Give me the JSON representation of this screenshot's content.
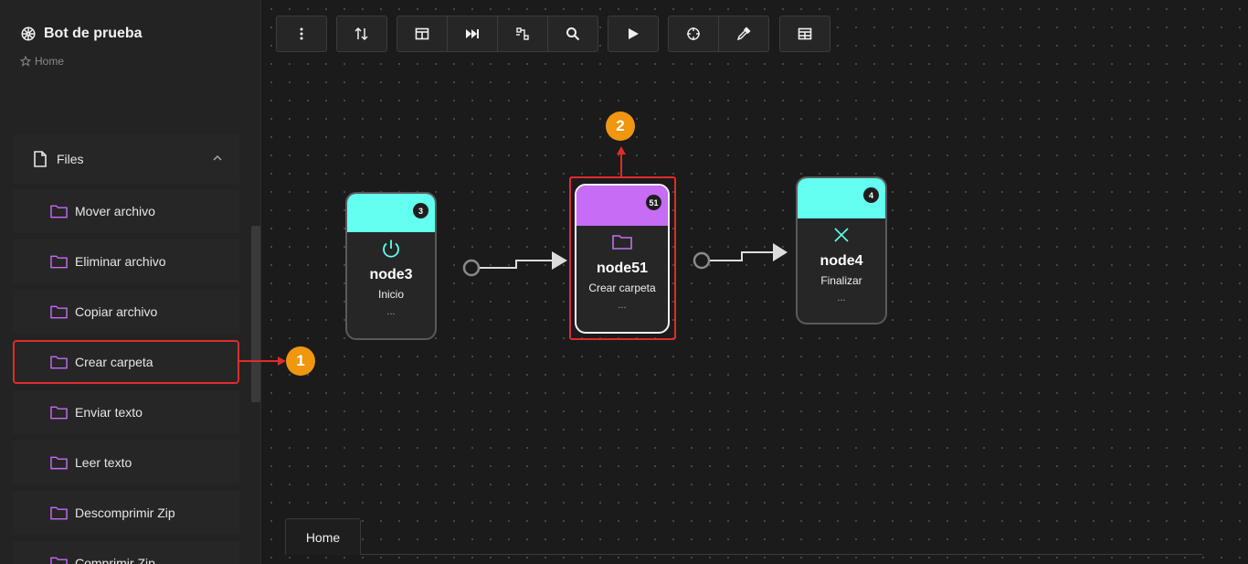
{
  "bot": {
    "title": "Bot de prueba",
    "breadcrumb": "Home"
  },
  "sidebar": {
    "section": "Files",
    "items": [
      {
        "label": "Mover archivo"
      },
      {
        "label": "Eliminar archivo"
      },
      {
        "label": "Copiar archivo"
      },
      {
        "label": "Crear carpeta"
      },
      {
        "label": "Enviar texto"
      },
      {
        "label": "Leer texto"
      },
      {
        "label": "Descomprimir Zip"
      },
      {
        "label": "Comprimir Zip"
      }
    ]
  },
  "toolbar": {
    "buttons": [
      "more-vertical-icon",
      "sort-icon",
      "columns-icon",
      "skip-forward-icon",
      "flow-icon",
      "search-icon",
      "play-icon",
      "crosshair-icon",
      "eyedropper-icon",
      "table-icon"
    ]
  },
  "nodes": [
    {
      "id": "node3",
      "badge": "3",
      "subtitle": "Inicio",
      "dots": "...",
      "color": "#63fff0",
      "icon": "power-icon"
    },
    {
      "id": "node51",
      "badge": "51",
      "subtitle": "Crear carpeta",
      "dots": "...",
      "color": "#c66cf5",
      "icon": "folder-icon"
    },
    {
      "id": "node4",
      "badge": "4",
      "subtitle": "Finalizar",
      "dots": "...",
      "color": "#63fff0",
      "icon": "close-icon"
    }
  ],
  "annotations": {
    "marker1": "1",
    "marker2": "2"
  },
  "tabs": {
    "active": "Home"
  },
  "colors": {
    "accent_folder": "#c66cf5",
    "accent_teal": "#63fff0",
    "highlight": "#e02b2b",
    "marker": "#f0960f"
  }
}
